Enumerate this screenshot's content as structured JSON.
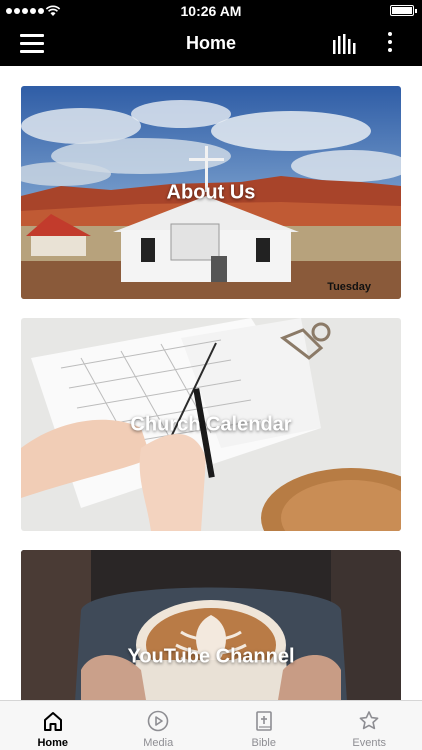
{
  "status_bar": {
    "time": "10:26 AM"
  },
  "nav": {
    "title": "Home"
  },
  "cards": [
    {
      "title": "About Us",
      "sign_text": "Tuesday"
    },
    {
      "title": "Church Calendar"
    },
    {
      "title": "YouTube Channel"
    }
  ],
  "tabs": [
    {
      "label": "Home",
      "icon": "home-icon",
      "active": true
    },
    {
      "label": "Media",
      "icon": "play-circle-icon",
      "active": false
    },
    {
      "label": "Bible",
      "icon": "bible-icon",
      "active": false
    },
    {
      "label": "Events",
      "icon": "star-icon",
      "active": false
    }
  ],
  "colors": {
    "bar_background": "#000000",
    "tab_active": "#000000",
    "tab_inactive": "#8e8e93"
  }
}
